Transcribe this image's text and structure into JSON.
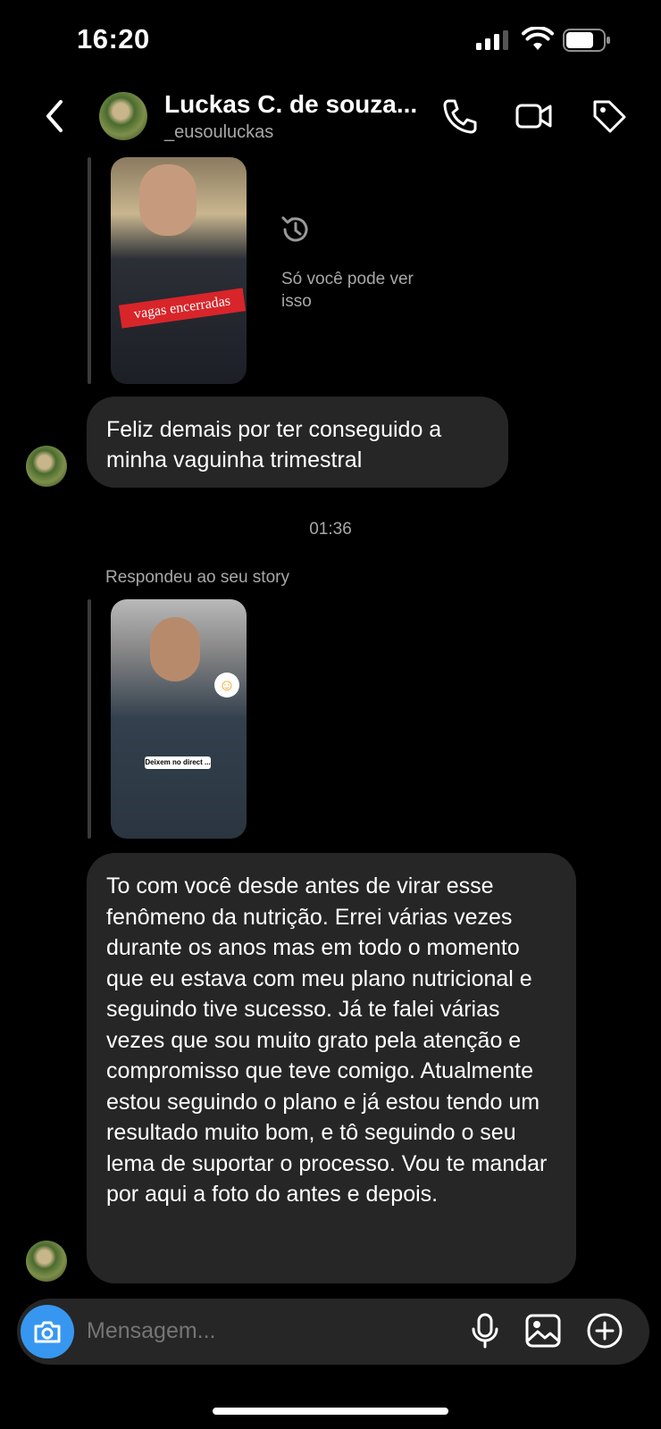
{
  "status": {
    "time": "16:20"
  },
  "header": {
    "name": "Luckas C. de souza...",
    "username": "_eusouluckas"
  },
  "story1": {
    "sticker": "vagas encerradas",
    "note": "Só você pode ver isso"
  },
  "messages": [
    {
      "text": "Feliz demais por ter conseguido a minha vaguinha trimestral"
    },
    {
      "text": "To com você desde antes de virar esse fenômeno da nutrição. Errei várias vezes durante os anos mas em todo o momento que eu estava com meu plano nutricional e seguindo tive sucesso. Já te falei várias vezes que sou muito grato pela atenção e compromisso que teve comigo. Atualmente estou seguindo o plano e já estou tendo um resultado muito bom, e tô seguindo o seu lema de suportar o processo. Vou te mandar por aqui a foto do antes e depois."
    }
  ],
  "timestamp": "01:36",
  "reply_label": "Respondeu ao seu story",
  "story2": {
    "caption": "Deixem no direct ..."
  },
  "composer": {
    "placeholder": "Mensagem..."
  },
  "icons": {
    "back": "chevron-left-icon",
    "call": "phone-icon",
    "video": "video-camera-icon",
    "tag": "tag-icon",
    "history": "history-icon",
    "camera": "camera-icon",
    "mic": "microphone-icon",
    "gallery": "image-icon",
    "add": "plus-circle-icon"
  },
  "colors": {
    "accent": "#3797f0",
    "bubble": "#262626",
    "background": "#000000"
  }
}
